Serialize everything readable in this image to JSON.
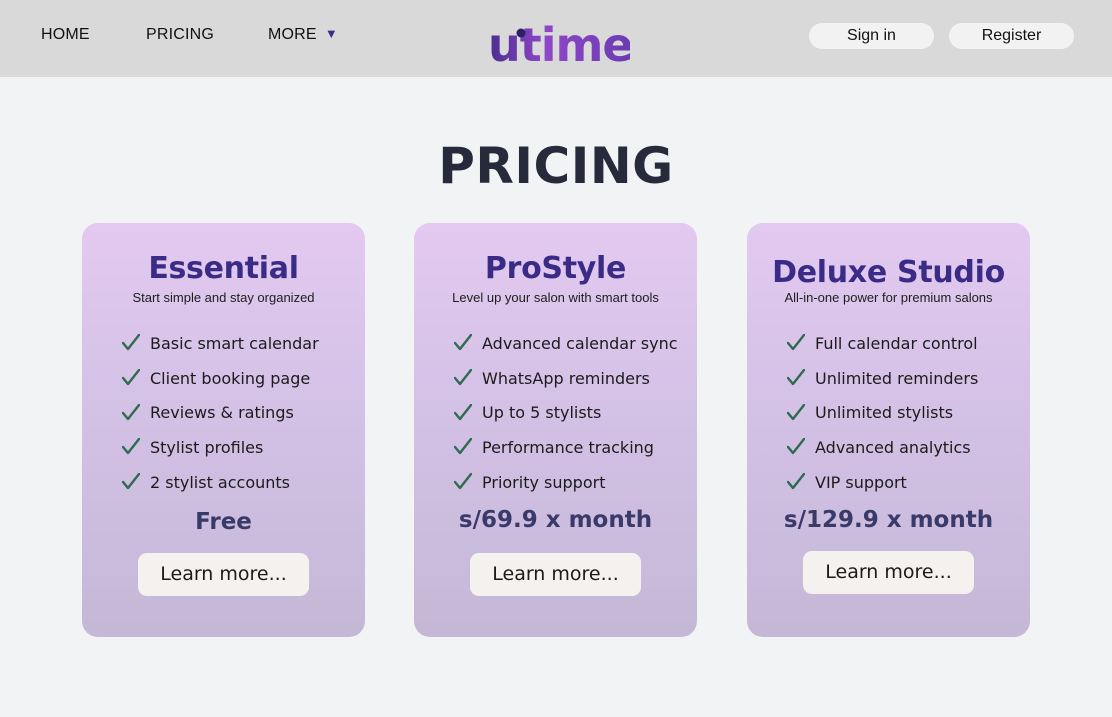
{
  "nav": {
    "home": "HOME",
    "pricing": "PRICING",
    "more": "MORE",
    "more_caret": "▼",
    "logo_text": "utime",
    "sign_in": "Sign in",
    "register": "Register"
  },
  "page": {
    "title": "PRICING"
  },
  "plans": [
    {
      "name": "Essential",
      "tagline": "Start simple and stay organized",
      "features": [
        "Basic smart calendar",
        "Client booking page",
        "Reviews & ratings",
        "Stylist profiles",
        "2 stylist accounts"
      ],
      "price": "Free",
      "button": "Learn more..."
    },
    {
      "name": "ProStyle",
      "tagline": "Level up your salon with smart tools",
      "features": [
        "Advanced calendar sync",
        "WhatsApp reminders",
        "Up to 5 stylists",
        "Performance tracking",
        "Priority support"
      ],
      "price": "s/69.9 x month",
      "button": "Learn more..."
    },
    {
      "name": "Deluxe Studio",
      "tagline": "All-in-one power for premium salons",
      "features": [
        "Full calendar control",
        "Unlimited reminders",
        "Unlimited stylists",
        "Advanced analytics",
        "VIP support"
      ],
      "price": "s/129.9 x month",
      "button": "Learn more..."
    }
  ],
  "colors": {
    "brand_purple": "#3a2b86",
    "logo_gradient_start": "#a14fd0",
    "logo_gradient_end": "#4b2d8f",
    "check_green": "#2e6b4f"
  },
  "icons": {
    "feature_bullet": "check-icon",
    "dropdown": "caret-down-icon"
  }
}
